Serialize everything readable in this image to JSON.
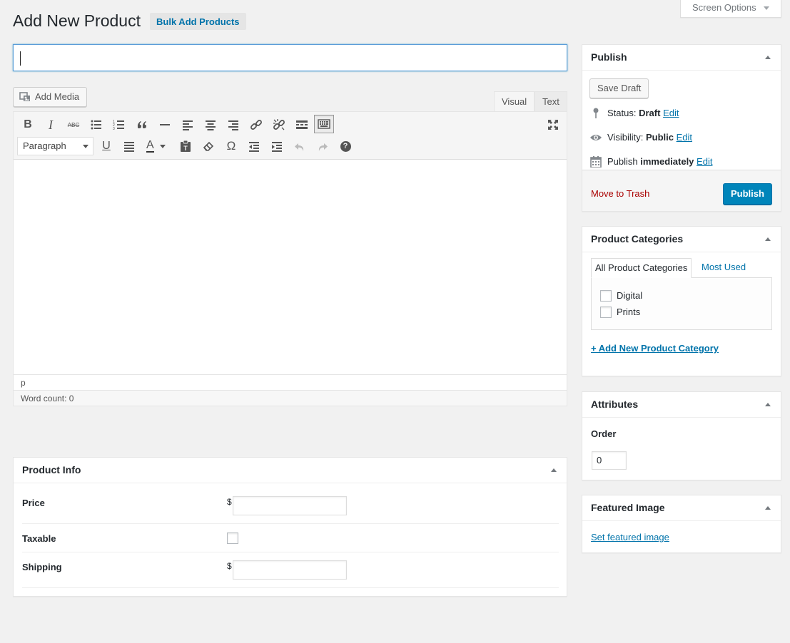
{
  "screen_options": {
    "label": "Screen Options"
  },
  "header": {
    "title": "Add New Product",
    "bulk_button": "Bulk Add Products"
  },
  "title_field": {
    "value": ""
  },
  "editor": {
    "add_media": "Add Media",
    "tabs": {
      "visual": "Visual",
      "text": "Text"
    },
    "format_select": "Paragraph",
    "path": "p",
    "word_count": "Word count: 0",
    "toolbar_row1": [
      "bold-icon",
      "italic-icon",
      "strikethrough-icon",
      "bullet-list-icon",
      "numbered-list-icon",
      "blockquote-icon",
      "horizontal-rule-icon",
      "align-left-icon",
      "align-center-icon",
      "align-right-icon",
      "insert-link-icon",
      "remove-link-icon",
      "read-more-icon",
      "toolbar-toggle-icon",
      "fullscreen-icon"
    ],
    "toolbar_row2": [
      "underline-icon",
      "justify-icon",
      "text-color-icon",
      "paste-text-icon",
      "clear-formatting-icon",
      "special-character-icon",
      "outdent-icon",
      "indent-icon",
      "undo-icon",
      "redo-icon",
      "help-icon"
    ],
    "bold_glyph": "B",
    "italic_glyph": "I",
    "strike_glyph": "ABC",
    "underline_glyph": "U",
    "color_glyph": "A",
    "omega_glyph": "Ω",
    "help_glyph": "?"
  },
  "product_info": {
    "title": "Product Info",
    "fields": [
      {
        "label": "Price",
        "prefix": "$",
        "value": ""
      },
      {
        "label": "Taxable",
        "checked": false
      },
      {
        "label": "Shipping",
        "prefix": "$",
        "value": ""
      }
    ]
  },
  "publish": {
    "title": "Publish",
    "save_draft": "Save Draft",
    "status_label": "Status:",
    "status_value": "Draft",
    "visibility_label": "Visibility:",
    "visibility_value": "Public",
    "publish_label": "Publish",
    "publish_value": "immediately",
    "edit_link": "Edit",
    "trash": "Move to Trash",
    "publish_button": "Publish"
  },
  "categories": {
    "title": "Product Categories",
    "tab_all": "All Product Categories",
    "tab_most_used": "Most Used",
    "items": [
      {
        "label": "Digital",
        "checked": false
      },
      {
        "label": "Prints",
        "checked": false
      }
    ],
    "add_new": "+ Add New Product Category"
  },
  "attributes": {
    "title": "Attributes",
    "order_label": "Order",
    "order_value": "0"
  },
  "featured_image": {
    "title": "Featured Image",
    "link": "Set featured image"
  },
  "colors": {
    "primary": "#0085ba",
    "link": "#0073aa",
    "trash": "#a00",
    "background": "#f1f1f1"
  }
}
